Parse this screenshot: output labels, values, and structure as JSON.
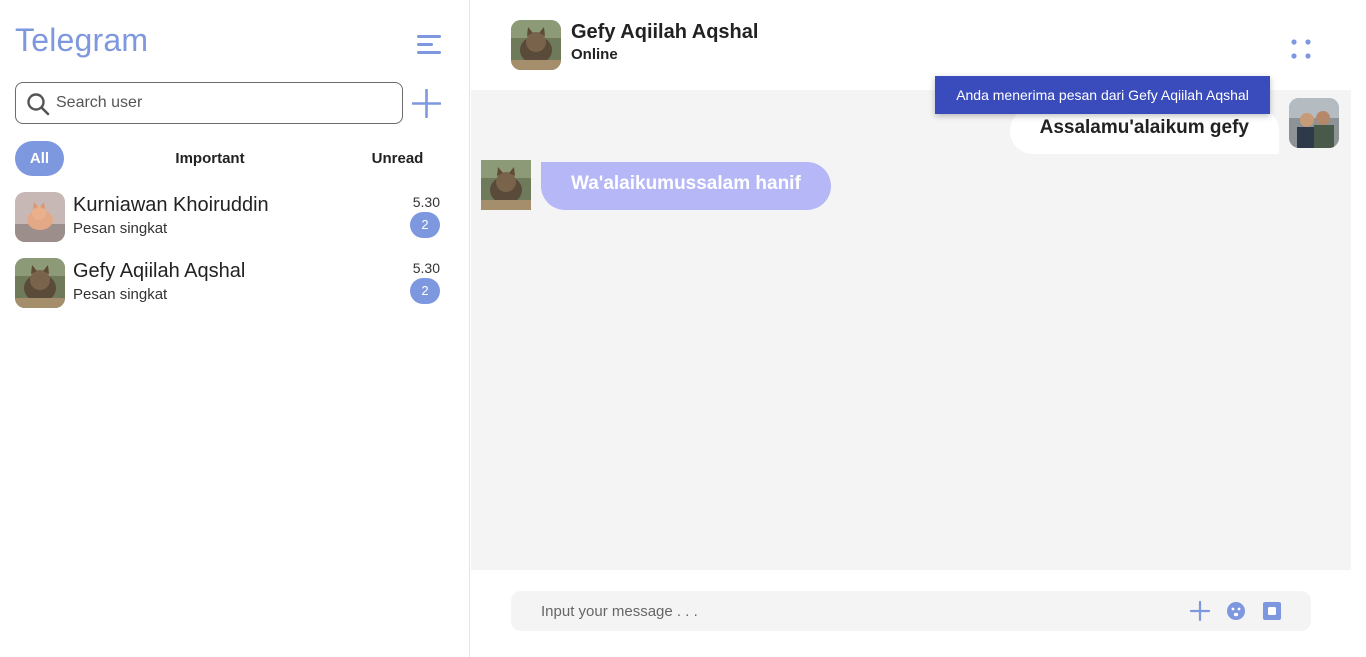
{
  "app": {
    "title": "Telegram"
  },
  "icons": {
    "menu": "menu-lines-icon",
    "search": "search-icon",
    "add": "plus-icon",
    "more": "dots-grid-icon",
    "attach": "plus-icon",
    "emoji": "emoji-icon",
    "camera": "camera-icon"
  },
  "colors": {
    "accent": "#7e98df",
    "bubble_in": "#b6b7f6",
    "toast": "#3a4bbb",
    "chat_bg": "#f5f4f5"
  },
  "search": {
    "placeholder": "Search user",
    "value": ""
  },
  "filters": [
    {
      "label": "All",
      "active": true
    },
    {
      "label": "Important",
      "active": false
    },
    {
      "label": "Unread",
      "active": false
    }
  ],
  "contacts": [
    {
      "name": "Kurniawan Khoiruddin",
      "preview": "Pesan singkat",
      "time": "5.30",
      "unread": "2"
    },
    {
      "name": "Gefy Aqiilah Aqshal",
      "preview": "Pesan singkat",
      "time": "5.30",
      "unread": "2"
    }
  ],
  "chat": {
    "name": "Gefy Aqiilah Aqshal",
    "status": "Online",
    "notification": "Anda menerima pesan dari Gefy Aqiilah Aqshal",
    "messages": [
      {
        "side": "right",
        "text": "Assalamu'alaikum gefy"
      },
      {
        "side": "left",
        "text": "Wa'alaikumussalam hanif"
      }
    ],
    "input_placeholder": "Input your message . . .",
    "input_value": ""
  }
}
